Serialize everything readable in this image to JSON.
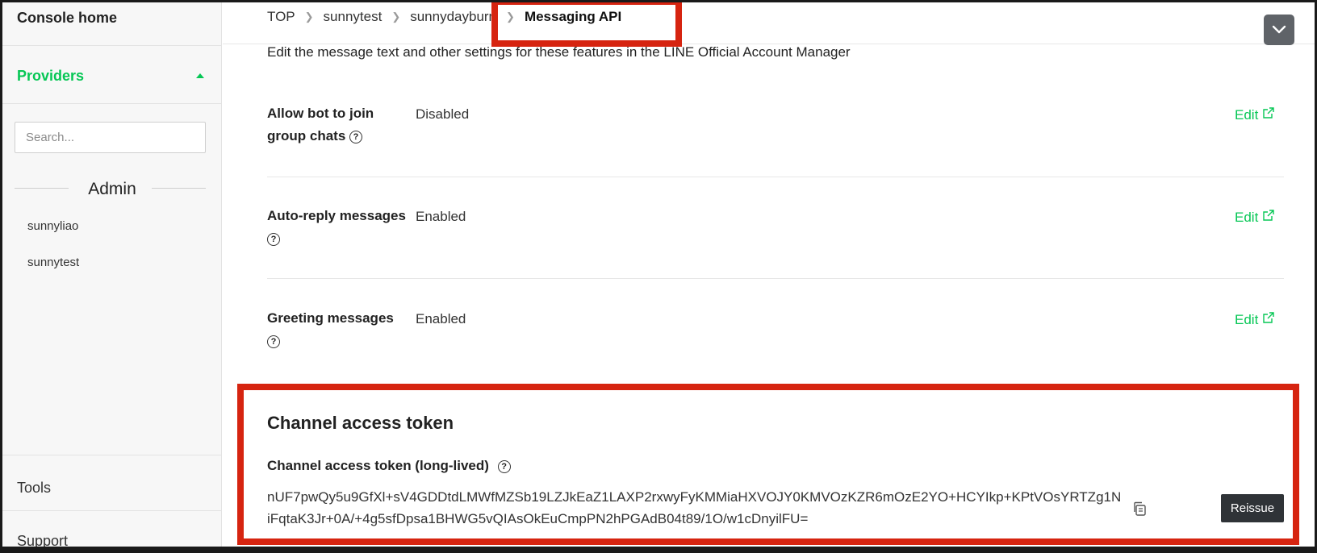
{
  "sidebar": {
    "console_home": "Console home",
    "providers": "Providers",
    "search_placeholder": "Search...",
    "section": "Admin",
    "items": [
      {
        "label": "sunnyliao"
      },
      {
        "label": "sunnytest"
      }
    ],
    "tools": "Tools",
    "support": "Support"
  },
  "breadcrumb": {
    "items": [
      "TOP",
      "sunnytest",
      "sunnydayburn"
    ],
    "current": "Messaging API"
  },
  "intro_text": "Edit the message text and other settings for these features in the LINE Official Account Manager",
  "settings": [
    {
      "label": "Allow bot to join group chats",
      "value": "Disabled",
      "edit": "Edit"
    },
    {
      "label": "Auto-reply messages",
      "value": "Enabled",
      "edit": "Edit"
    },
    {
      "label": "Greeting messages",
      "value": "Enabled",
      "edit": "Edit"
    }
  ],
  "token": {
    "title": "Channel access token",
    "label": "Channel access token (long-lived)",
    "value": "nUF7pwQy5u9GfXl+sV4GDDtdLMWfMZSb19LZJkEaZ1LAXP2rxwyFyKMMiaHXVOJY0KMVOzKZR6mOzE2YO+HCYIkp+KPtVOsYRTZg1NiFqtaK3Jr+0A/+4g5sfDpsa1BHWG5vQIAsOkEuCmpPN2hPGAdB04t89/1O/w1cDnyilFU=",
    "reissue": "Reissue"
  },
  "colors": {
    "accent": "#06c755",
    "highlight": "#d62410",
    "dark_button": "#2f3337"
  }
}
